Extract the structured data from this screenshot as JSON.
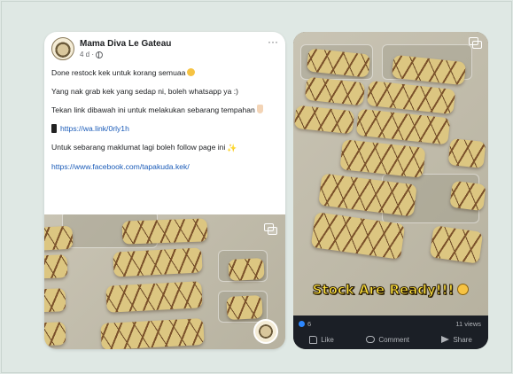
{
  "post": {
    "page_name": "Mama Diva Le Gateau",
    "time": "4 d ·",
    "more": "···",
    "line1": "Done restock kek untuk korang semuaa",
    "line2": "Yang nak grab kek yang sedap ni, boleh whatsapp ya :)",
    "line3": "Tekan link dibawah ini untuk melakukan sebarang tempahan",
    "whatsapp_link": "https://wa.link/0rly1h",
    "line4": "Untuk sebarang maklumat lagi boleh follow page ini",
    "facebook_link": "https://www.facebook.com/tapakuda.kek/"
  },
  "reel": {
    "overlay_text": "Stock Are Ready!!!",
    "like_count": "6",
    "views": "11 views",
    "like_label": "Like",
    "comment_label": "Comment",
    "share_label": "Share"
  },
  "colors": {
    "background": "#dfe8e4",
    "link": "#1a5bb8",
    "overlay_text": "#ffe23b",
    "reel_footer": "#1b1f26"
  }
}
